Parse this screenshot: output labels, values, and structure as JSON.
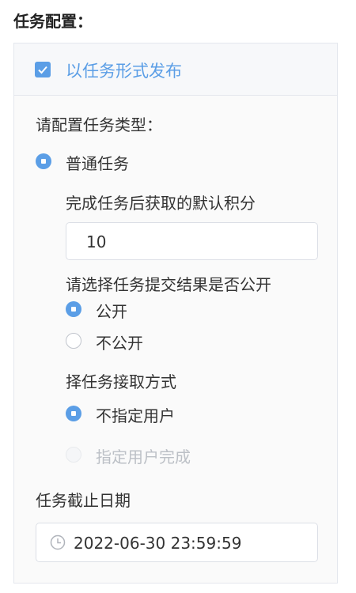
{
  "section_title": "任务配置：",
  "publish_as_task": {
    "label": "以任务形式发布",
    "checked": true
  },
  "task_type": {
    "heading": "请配置任务类型：",
    "selected_label": "普通任务",
    "selected": true
  },
  "points": {
    "label": "完成任务后获取的默认积分",
    "value": "10"
  },
  "result_public": {
    "question": "请选择任务提交结果是否公开",
    "options": [
      {
        "label": "公开",
        "selected": true
      },
      {
        "label": "不公开",
        "selected": false
      }
    ]
  },
  "accept_method": {
    "question": "择任务接取方式",
    "options": [
      {
        "label": "不指定用户",
        "selected": true,
        "disabled": false
      },
      {
        "label": "指定用户完成",
        "selected": false,
        "disabled": true
      }
    ]
  },
  "deadline": {
    "label": "任务截止日期",
    "value": "2022-06-30 23:59:59",
    "icon": "clock-icon"
  },
  "colors": {
    "accent": "#5b9ee6",
    "border": "#e4e7ed",
    "disabled": "#bcc0c6"
  }
}
